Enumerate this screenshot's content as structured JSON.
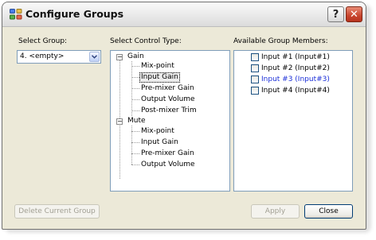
{
  "window": {
    "title": "Configure Groups",
    "help_glyph": "?",
    "close_glyph": "✕"
  },
  "select_group": {
    "label": "Select Group:",
    "value": "4. <empty>"
  },
  "control_type": {
    "label": "Select Control Type:",
    "tree": [
      {
        "label": "Gain",
        "expanded": true,
        "children": [
          "Mix-point",
          "Input Gain",
          "Pre-mixer Gain",
          "Output Volume",
          "Post-mixer Trim"
        ]
      },
      {
        "label": "Mute",
        "expanded": true,
        "children": [
          "Mix-point",
          "Input Gain",
          "Pre-mixer Gain",
          "Output Volume"
        ]
      }
    ],
    "selected": "Input Gain",
    "collapse_glyph": "−"
  },
  "members": {
    "label": "Available Group Members:",
    "items": [
      {
        "label": "Input #1 (Input#1)",
        "checked": false,
        "color": "#000000"
      },
      {
        "label": "Input #2 (Input#2)",
        "checked": false,
        "color": "#000000"
      },
      {
        "label": "Input #3 (Input#3)",
        "checked": false,
        "color": "#1a2ed8"
      },
      {
        "label": "Input #4 (Input#4)",
        "checked": false,
        "color": "#000000"
      }
    ]
  },
  "buttons": {
    "delete": "Delete Current Group",
    "apply": "Apply",
    "close": "Close"
  },
  "colors": {
    "dialog_bg": "#ece9d8",
    "border_blue": "#7f9db9",
    "highlight_text": "#1a2ed8"
  }
}
